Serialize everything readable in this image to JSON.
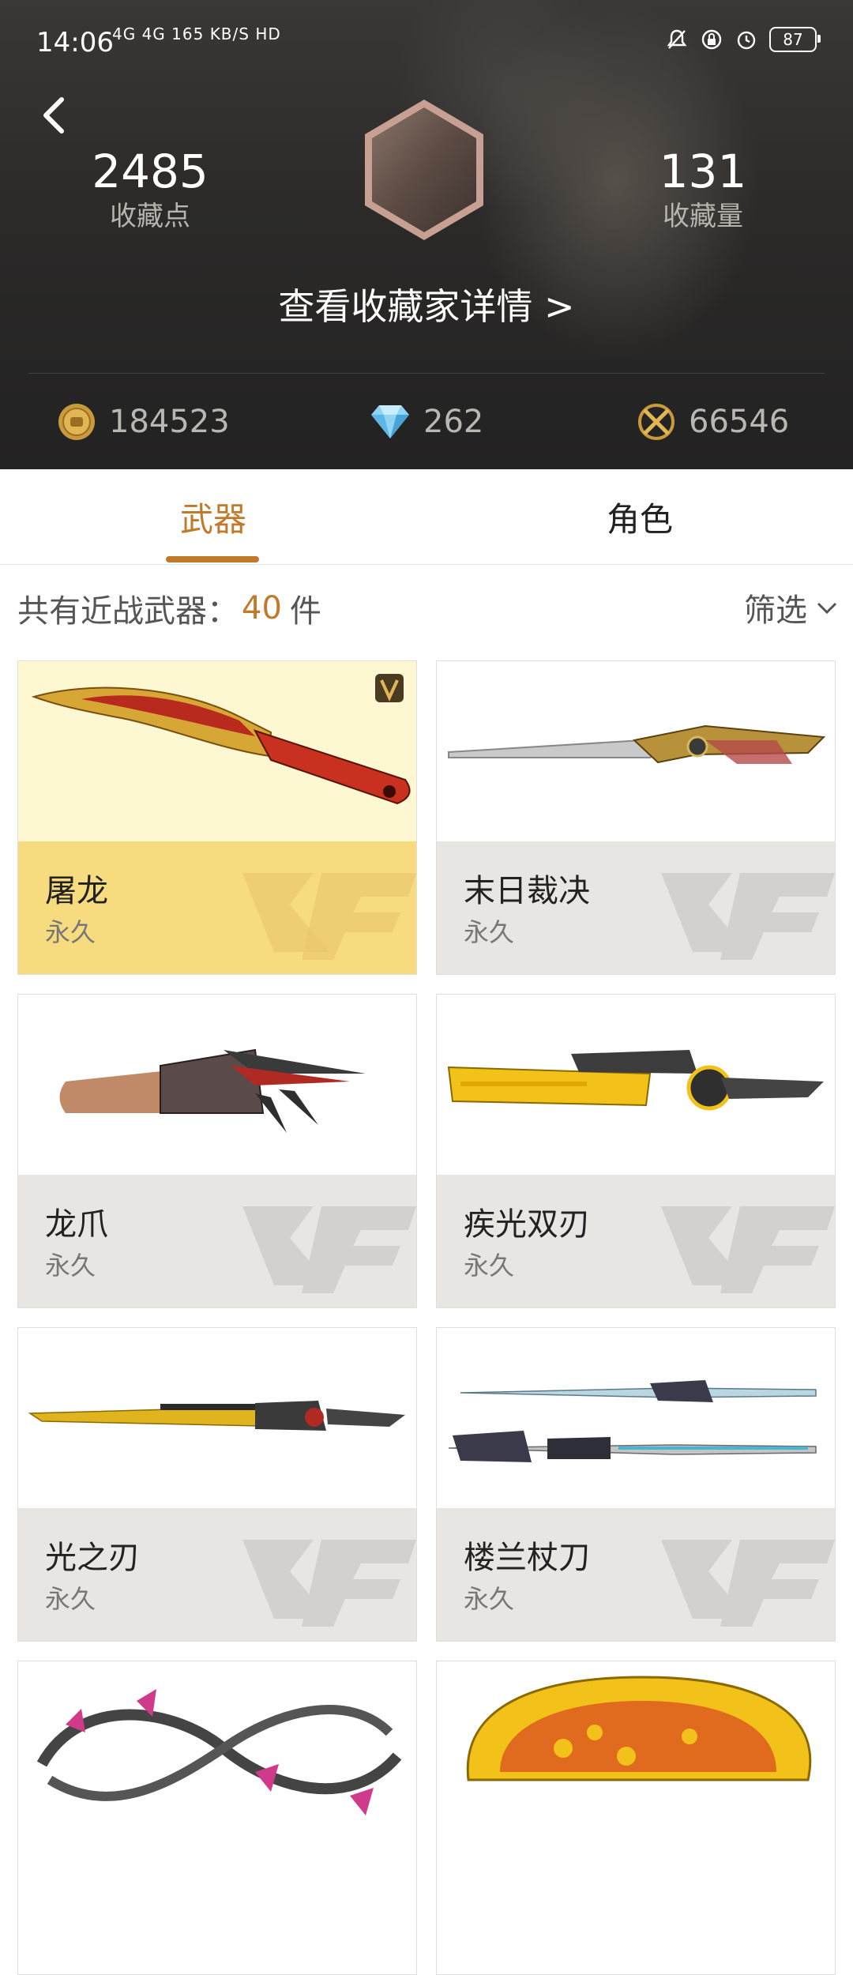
{
  "status_bar": {
    "time": "14:06",
    "network": "4G 4G 165 KB/S HD",
    "battery": "87"
  },
  "header": {
    "points_value": "2485",
    "points_label": "收藏点",
    "count_value": "131",
    "count_label": "收藏量",
    "detail_link": "查看收藏家详情 >",
    "currencies": [
      {
        "icon": "gold-coin-icon",
        "value": "184523"
      },
      {
        "icon": "diamond-icon",
        "value": "262"
      },
      {
        "icon": "crossed-swords-ticket-icon",
        "value": "66546"
      }
    ]
  },
  "tabs": [
    {
      "label": "武器",
      "active": true
    },
    {
      "label": "角色",
      "active": false
    }
  ],
  "summary": {
    "prefix": "共有近战武器：",
    "count": "40",
    "unit": "件",
    "filter_label": "筛选"
  },
  "items": [
    {
      "name": "屠龙",
      "duration": "永久",
      "highlight": true,
      "icon": "dragon-kukri-knife-icon"
    },
    {
      "name": "末日裁决",
      "duration": "永久",
      "highlight": false,
      "icon": "long-blade-icon"
    },
    {
      "name": "龙爪",
      "duration": "永久",
      "highlight": false,
      "icon": "claw-gauntlet-icon"
    },
    {
      "name": "疾光双刃",
      "duration": "永久",
      "highlight": false,
      "icon": "yellow-blade-icon"
    },
    {
      "name": "光之刃",
      "duration": "永久",
      "highlight": false,
      "icon": "gold-sword-icon"
    },
    {
      "name": "楼兰杖刀",
      "duration": "永久",
      "highlight": false,
      "icon": "staff-blades-icon"
    },
    {
      "name": "",
      "duration": "",
      "highlight": false,
      "icon": "chain-blade-icon"
    },
    {
      "name": "",
      "duration": "",
      "highlight": false,
      "icon": "yellow-slipper-icon"
    }
  ],
  "colors": {
    "accent": "#c07a2a",
    "gold_card": "#f7dc7f",
    "card_footer": "#e8e6e3"
  }
}
